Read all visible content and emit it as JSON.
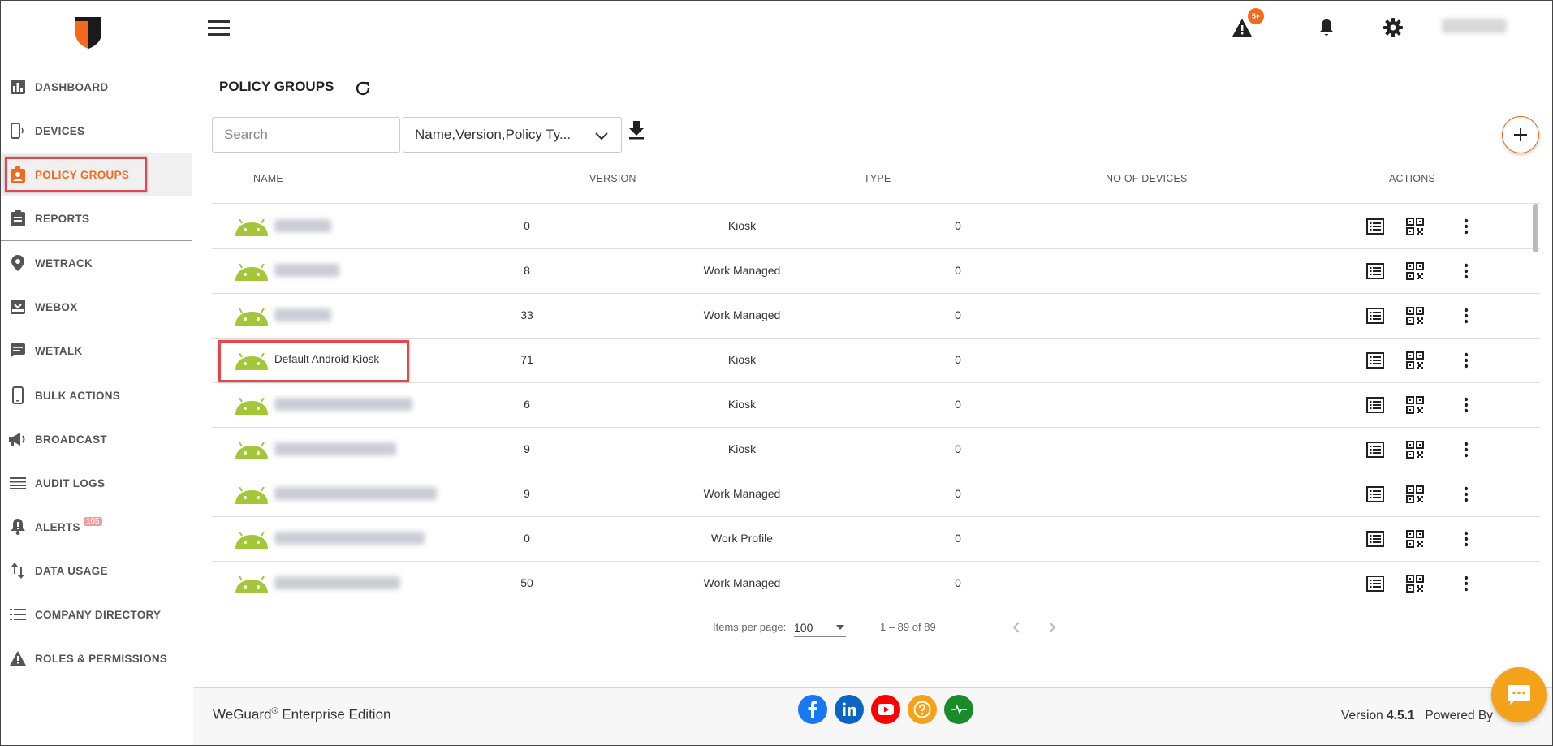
{
  "sidebar": {
    "items": [
      {
        "label": "DASHBOARD",
        "icon": "bar-chart-icon"
      },
      {
        "label": "DEVICES",
        "icon": "device-icon"
      },
      {
        "label": "POLICY GROUPS",
        "icon": "policy-badge-icon",
        "active": true
      },
      {
        "label": "REPORTS",
        "icon": "clipboard-icon"
      },
      {
        "label": "WETRACK",
        "icon": "location-pin-icon"
      },
      {
        "label": "WEBOX",
        "icon": "inbox-icon"
      },
      {
        "label": "WETALK",
        "icon": "chat-icon"
      },
      {
        "label": "BULK ACTIONS",
        "icon": "phone-icon"
      },
      {
        "label": "BROADCAST",
        "icon": "megaphone-icon"
      },
      {
        "label": "AUDIT LOGS",
        "icon": "list-lines-icon"
      },
      {
        "label": "ALERTS",
        "icon": "bell-alert-icon",
        "badge": "105"
      },
      {
        "label": "DATA USAGE",
        "icon": "up-down-arrows-icon"
      },
      {
        "label": "COMPANY DIRECTORY",
        "icon": "directory-list-icon"
      },
      {
        "label": "ROLES & PERMISSIONS",
        "icon": "warning-triangle-icon"
      }
    ]
  },
  "topbar": {
    "alerts_count": "5+"
  },
  "page": {
    "title": "POLICY GROUPS"
  },
  "search": {
    "placeholder": "Search"
  },
  "column_select": {
    "value": "Name,Version,Policy Ty..."
  },
  "table": {
    "headers": {
      "name": "NAME",
      "version": "VERSION",
      "type": "TYPE",
      "devices": "NO OF DEVICES",
      "actions": "ACTIONS"
    },
    "rows": [
      {
        "version": "0",
        "type": "Kiosk",
        "devices": "0"
      },
      {
        "version": "8",
        "type": "Work Managed",
        "devices": "0"
      },
      {
        "version": "33",
        "type": "Work Managed",
        "devices": "0"
      },
      {
        "name": "Default Android Kiosk",
        "version": "71",
        "type": "Kiosk",
        "devices": "0",
        "highlighted": true
      },
      {
        "version": "6",
        "type": "Kiosk",
        "devices": "0"
      },
      {
        "version": "9",
        "type": "Kiosk",
        "devices": "0"
      },
      {
        "version": "9",
        "type": "Work Managed",
        "devices": "0"
      },
      {
        "version": "0",
        "type": "Work Profile",
        "devices": "0"
      },
      {
        "version": "50",
        "type": "Work Managed",
        "devices": "0"
      }
    ]
  },
  "pagination": {
    "items_per_page_label": "Items per page:",
    "items_per_page": "100",
    "range": "1 – 89 of 89"
  },
  "footer": {
    "brand": "WeGuard",
    "brand_mark": "®",
    "edition": "Enterprise Edition",
    "version_label": "Version",
    "version": "4.5.1",
    "powered_by": "Powered By"
  },
  "colors": {
    "accent": "#f26b1d",
    "highlight_border": "#e2474b",
    "android_green": "#a4c639",
    "facebook": "#1877f2",
    "linkedin": "#0a66c2",
    "youtube": "#ff0000",
    "help": "#f5a21b",
    "status": "#1b8a2a"
  }
}
